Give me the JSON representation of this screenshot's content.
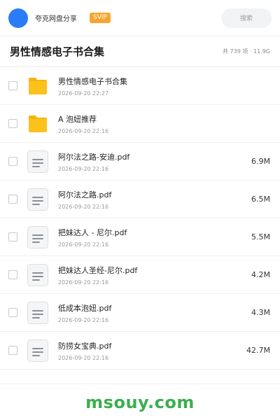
{
  "header": {
    "app_name": "夸克网盘分享",
    "badge": "SVIP",
    "search_placeholder": "搜索"
  },
  "folder": {
    "title": "男性情感电子书合集",
    "meta": "共 739 项 · 11.9G"
  },
  "files": [
    {
      "type": "folder",
      "name": "男性情感电子书合集",
      "date": "2026-09-20 22:27",
      "size": ""
    },
    {
      "type": "folder",
      "name": "A 泡妞推荐",
      "date": "2026-09-20 22:16",
      "size": ""
    },
    {
      "type": "file",
      "name": "阿尔法之路-安迪.pdf",
      "date": "2026-09-20 22:16",
      "size": "6.9M"
    },
    {
      "type": "file",
      "name": "阿尔法之路.pdf",
      "date": "2026-09-20 22:16",
      "size": "6.5M"
    },
    {
      "type": "file",
      "name": "把妹达人 - 尼尔.pdf",
      "date": "2026-09-20 22:16",
      "size": "5.5M"
    },
    {
      "type": "file",
      "name": "把妹达人圣经-尼尔.pdf",
      "date": "2026-09-20 22:16",
      "size": "4.2M"
    },
    {
      "type": "file",
      "name": "低成本泡妞.pdf",
      "date": "2026-09-20 22:16",
      "size": "4.3M"
    },
    {
      "type": "file",
      "name": "防捞女宝典.pdf",
      "date": "2026-09-20 22:16",
      "size": "42.7M"
    }
  ],
  "watermark": "msouy.com",
  "colors": {
    "avatar": "#2a7cf7",
    "svip": "#f7a531",
    "folder": "#fcc21b",
    "watermark": "#3cae4f"
  }
}
